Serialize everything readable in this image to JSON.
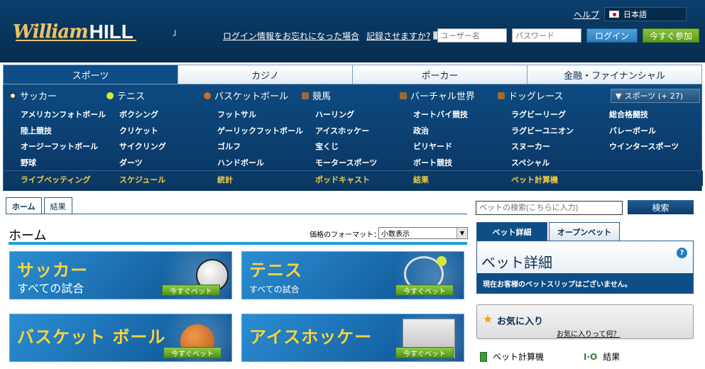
{
  "header": {
    "logo_script": "William",
    "logo_hill": "HILL",
    "quote_mark": "」",
    "help": "ヘルプ",
    "language": "日本語",
    "forgot_login": "ログイン情報をお忘れになった場合",
    "remember": "記録させますか?",
    "username_placeholder": "ユーザー名",
    "password_placeholder": "パスワード",
    "login_button": "ログイン",
    "join_button": "今すぐ参加"
  },
  "topnav": {
    "tabs": [
      "スポーツ",
      "カジノ",
      "ポーカー",
      "金融・ファイナンシャル"
    ]
  },
  "sports": {
    "main": [
      "サッカー",
      "テニス",
      "バスケットボール",
      "競馬",
      "バーチャル世界",
      "ドッグレース"
    ],
    "more": "スポーツ (+ 27)",
    "sub": [
      [
        "アメリカンフォトボール",
        "ボクシング",
        "フットサル",
        "ハーリング",
        "オートバイ競技",
        "ラグビーリーグ",
        "総合格闘技"
      ],
      [
        "陸上競技",
        "クリケット",
        "ゲーリックフットボール",
        "アイスホッケー",
        "政治",
        "ラグビーユニオン",
        "バレーボール"
      ],
      [
        "オージーフットボール",
        "サイクリング",
        "ゴルフ",
        "宝くじ",
        "ビリヤード",
        "スヌーカー",
        "ウインタースポーツ"
      ],
      [
        "野球",
        "ダーツ",
        "ハンドボール",
        "モータースポーツ",
        "ボート競技",
        "スペシャル"
      ]
    ],
    "bottom": [
      "ライブベッティング",
      "スケジュール",
      "統計",
      "ポッドキャスト",
      "結果",
      "ベット計算機"
    ]
  },
  "content": {
    "tab_home": "ホーム",
    "tab_results": "結果",
    "title": "ホーム",
    "price_format_label": "価格のフォーマット：",
    "price_format_value": "小数表示"
  },
  "cards": [
    {
      "title": "サッカー",
      "sub": "すべての試合",
      "button": "今すぐベット"
    },
    {
      "title": "テニス",
      "sub": "すべての試合",
      "button": "今すぐベット"
    },
    {
      "title": "バスケット ボール",
      "sub": "",
      "button": "今すぐベット"
    },
    {
      "title": "アイスホッケー",
      "sub": "",
      "button": "今すぐベット"
    }
  ],
  "sidebar": {
    "search_placeholder": "ベットの検索(こちらに入力)",
    "search_button": "検索",
    "tab_betslip": "ベット詳細",
    "tab_open": "オープンベット",
    "panel_title": "ベット詳細",
    "panel_help": "?",
    "panel_message": "現在お客様のベットスリップはございません。",
    "fav_title": "お気に入り",
    "fav_link": "お気に入りって何？",
    "tool_calc": "ベット計算機",
    "tool_result_icon": "I·O",
    "tool_results": "結果"
  }
}
